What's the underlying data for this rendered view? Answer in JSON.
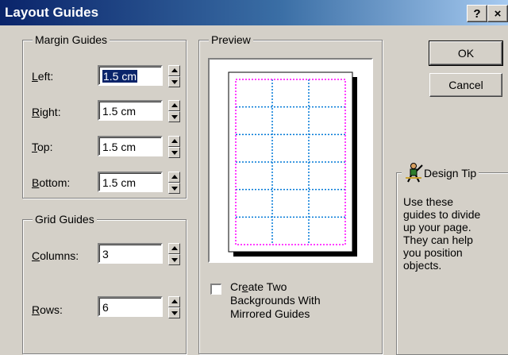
{
  "window": {
    "title": "Layout Guides",
    "help_button": "?",
    "close_button": "×"
  },
  "margin_guides": {
    "legend": "Margin Guides",
    "fields": [
      {
        "label_key": "L",
        "label_rest": "eft:",
        "value": "1.5 cm",
        "selected": true
      },
      {
        "label_key": "R",
        "label_rest": "ight:",
        "value": "1.5 cm"
      },
      {
        "label_key": "T",
        "label_rest": "op:",
        "value": "1.5 cm"
      },
      {
        "label_key": "B",
        "label_rest": "ottom:",
        "value": "1.5 cm"
      }
    ]
  },
  "grid_guides": {
    "legend": "Grid Guides",
    "columns": {
      "label_key": "C",
      "label_rest": "olumns:",
      "value": "3"
    },
    "rows": {
      "label_key": "R",
      "label_rest": "ows:",
      "value": "6"
    }
  },
  "preview": {
    "legend": "Preview",
    "columns": 3,
    "rows": 6,
    "margin_color": "#ff00ff",
    "grid_color": "#0078d7"
  },
  "mirror_option": {
    "line1_pre": "Cr",
    "line1_key": "e",
    "line1_post": "ate Two",
    "line2": "Backgrounds With",
    "line3": "Mirrored Guides",
    "checked": false
  },
  "buttons": {
    "ok": "OK",
    "cancel": "Cancel"
  },
  "design_tip": {
    "legend": "Design Tip",
    "icon": "design-tip-figure-icon",
    "lines": [
      "Use these",
      "guides to divide",
      "up your page.",
      "They can help",
      "you position",
      "objects."
    ]
  }
}
